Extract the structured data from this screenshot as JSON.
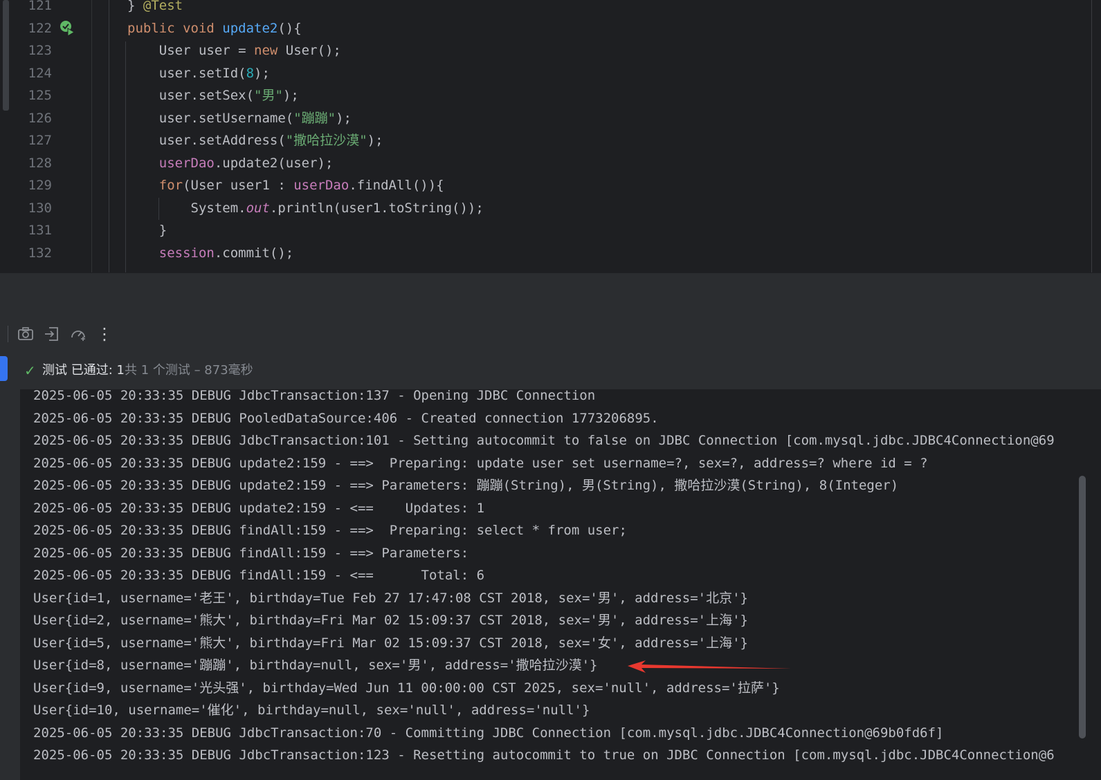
{
  "editor": {
    "lines": [
      {
        "num": "121",
        "parts": [
          [
            "",
            "} "
          ],
          [
            "ann",
            "@Test"
          ]
        ]
      },
      {
        "num": "122",
        "parts": [
          [
            "kw",
            "public void "
          ],
          [
            "fn",
            "update2"
          ],
          [
            "",
            "(){"
          ]
        ]
      },
      {
        "num": "123",
        "parts": [
          [
            "",
            "    User user = "
          ],
          [
            "kw",
            "new "
          ],
          [
            "",
            "User();"
          ]
        ]
      },
      {
        "num": "124",
        "parts": [
          [
            "",
            "    user.setId("
          ],
          [
            "num",
            "8"
          ],
          [
            "",
            ");"
          ]
        ]
      },
      {
        "num": "125",
        "parts": [
          [
            "",
            "    user.setSex("
          ],
          [
            "str",
            "\"男\""
          ],
          [
            "",
            ");"
          ]
        ]
      },
      {
        "num": "126",
        "parts": [
          [
            "",
            "    user.setUsername("
          ],
          [
            "str",
            "\"蹦蹦\""
          ],
          [
            "",
            ");"
          ]
        ]
      },
      {
        "num": "127",
        "parts": [
          [
            "",
            "    user.setAddress("
          ],
          [
            "str",
            "\"撒哈拉沙漠\""
          ],
          [
            "",
            ");"
          ]
        ]
      },
      {
        "num": "128",
        "parts": [
          [
            "fld",
            "    userDao"
          ],
          [
            "",
            ".update2(user);"
          ]
        ]
      },
      {
        "num": "129",
        "parts": [
          [
            "kw",
            "    for"
          ],
          [
            "",
            "(User user1 : "
          ],
          [
            "fld",
            "userDao"
          ],
          [
            "",
            ".findAll()){"
          ]
        ]
      },
      {
        "num": "130",
        "parts": [
          [
            "",
            "        System."
          ],
          [
            "fld ital",
            "out"
          ],
          [
            "",
            ".println(user1.toString());"
          ]
        ]
      },
      {
        "num": "131",
        "parts": [
          [
            "",
            "    }"
          ]
        ]
      },
      {
        "num": "132",
        "parts": [
          [
            "fld",
            "    session"
          ],
          [
            "",
            ".commit();"
          ]
        ]
      }
    ]
  },
  "toolbar": {
    "icons": [
      "camera-icon",
      "import-icon",
      "coverage-icon",
      "more-vertical-icon"
    ],
    "more_glyph": "⋮"
  },
  "status": {
    "check_glyph": "✓",
    "passed_label": "测试 已通过: 1",
    "summary": "共 1 个测试 – 873毫秒"
  },
  "console": {
    "lines": [
      "2025-06-05 20:33:35 DEBUG JdbcTransaction:137 - Opening JDBC Connection",
      "2025-06-05 20:33:35 DEBUG PooledDataSource:406 - Created connection 1773206895.",
      "2025-06-05 20:33:35 DEBUG JdbcTransaction:101 - Setting autocommit to false on JDBC Connection [com.mysql.jdbc.JDBC4Connection@69",
      "2025-06-05 20:33:35 DEBUG update2:159 - ==>  Preparing: update user set username=?, sex=?, address=? where id = ?",
      "2025-06-05 20:33:35 DEBUG update2:159 - ==> Parameters: 蹦蹦(String), 男(String), 撒哈拉沙漠(String), 8(Integer)",
      "2025-06-05 20:33:35 DEBUG update2:159 - <==    Updates: 1",
      "2025-06-05 20:33:35 DEBUG findAll:159 - ==>  Preparing: select * from user;",
      "2025-06-05 20:33:35 DEBUG findAll:159 - ==> Parameters: ",
      "2025-06-05 20:33:35 DEBUG findAll:159 - <==      Total: 6",
      "User{id=1, username='老王', birthday=Tue Feb 27 17:47:08 CST 2018, sex='男', address='北京'}",
      "User{id=2, username='熊大', birthday=Fri Mar 02 15:09:37 CST 2018, sex='男', address='上海'}",
      "User{id=5, username='熊大', birthday=Fri Mar 02 15:09:37 CST 2018, sex='女', address='上海'}",
      "User{id=8, username='蹦蹦', birthday=null, sex='男', address='撒哈拉沙漠'}",
      "User{id=9, username='光头强', birthday=Wed Jun 11 00:00:00 CST 2025, sex='null', address='拉萨'}",
      "User{id=10, username='催化', birthday=null, sex='null', address='null'}",
      "2025-06-05 20:33:35 DEBUG JdbcTransaction:70 - Committing JDBC Connection [com.mysql.jdbc.JDBC4Connection@69b0fd6f]",
      "2025-06-05 20:33:35 DEBUG JdbcTransaction:123 - Resetting autocommit to true on JDBC Connection [com.mysql.jdbc.JDBC4Connection@6"
    ]
  },
  "colors": {
    "arrow": "#e8382f",
    "passed": "#5fb865"
  }
}
